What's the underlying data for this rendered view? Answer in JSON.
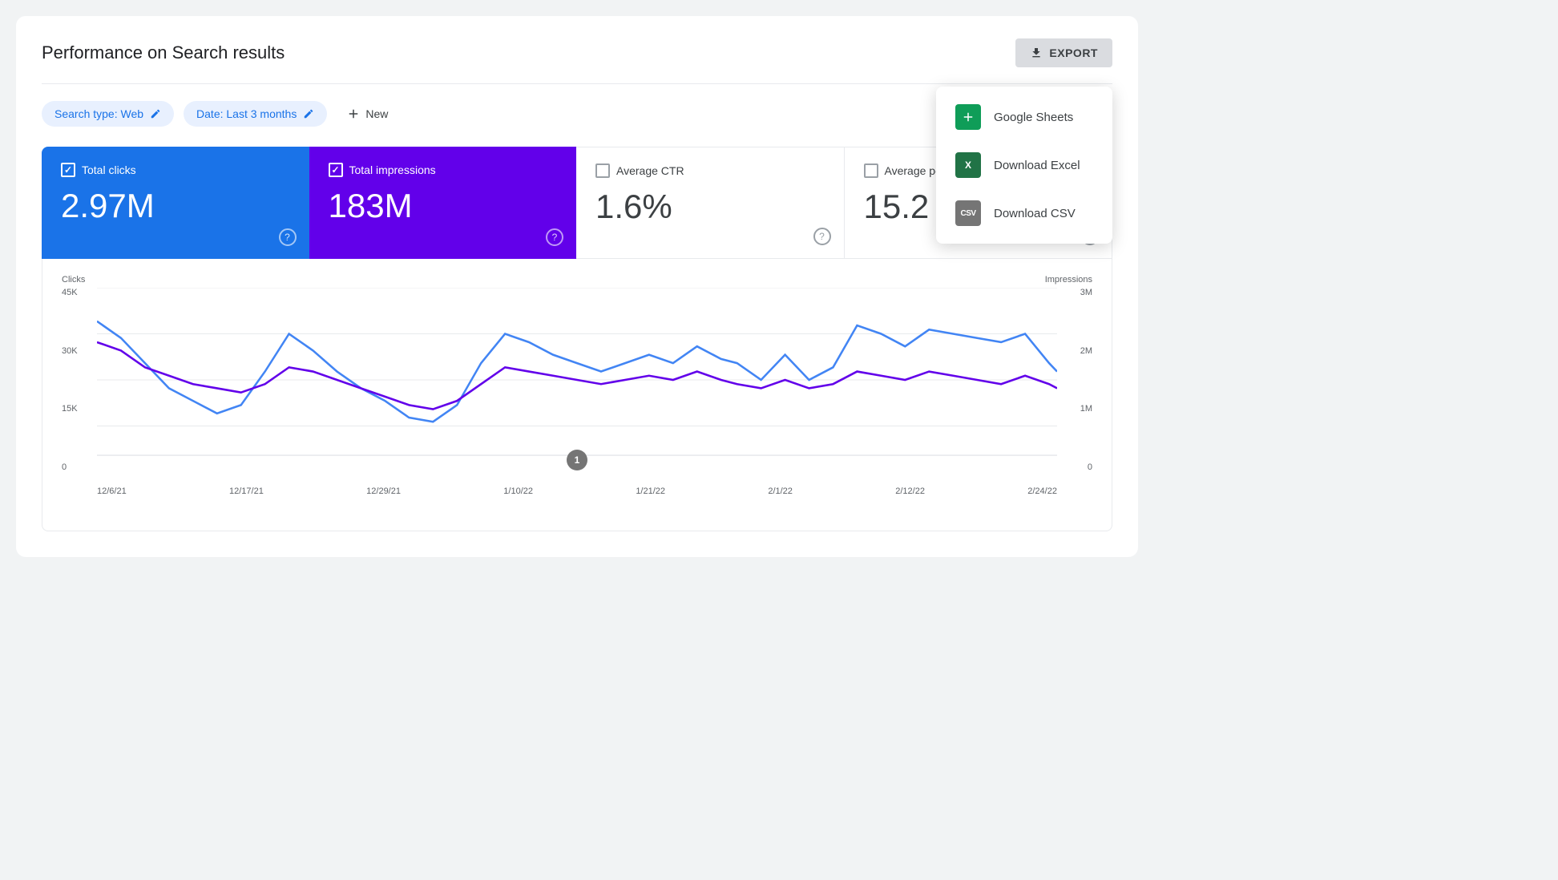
{
  "page": {
    "title": "Performance on Search results"
  },
  "header": {
    "export_label": "EXPORT"
  },
  "filters": {
    "search_type_label": "Search type: Web",
    "date_label": "Date: Last 3 months",
    "new_label": "New"
  },
  "metrics": [
    {
      "id": "clicks",
      "label": "Total clicks",
      "value": "2.97M",
      "checked": true,
      "color": "blue"
    },
    {
      "id": "impressions",
      "label": "Total impressions",
      "value": "183M",
      "checked": true,
      "color": "purple"
    },
    {
      "id": "ctr",
      "label": "Average CTR",
      "value": "1.6%",
      "checked": false,
      "color": "white"
    },
    {
      "id": "position",
      "label": "Average position",
      "value": "15.2",
      "checked": false,
      "color": "white"
    }
  ],
  "chart": {
    "y_left_labels": [
      "45K",
      "30K",
      "15K",
      "0"
    ],
    "y_right_labels": [
      "3M",
      "2M",
      "1M",
      "0"
    ],
    "x_labels": [
      "12/6/21",
      "12/17/21",
      "12/29/21",
      "1/10/22",
      "1/21/22",
      "2/1/22",
      "2/12/22",
      "2/24/22"
    ],
    "left_axis_title": "Clicks",
    "right_axis_title": "Impressions",
    "badge_number": "1"
  },
  "dropdown": {
    "items": [
      {
        "id": "google-sheets",
        "label": "Google Sheets",
        "icon_type": "sheets",
        "icon_text": "+"
      },
      {
        "id": "download-excel",
        "label": "Download Excel",
        "icon_type": "excel",
        "icon_text": "X"
      },
      {
        "id": "download-csv",
        "label": "Download CSV",
        "icon_type": "csv",
        "icon_text": "CSV"
      }
    ]
  }
}
